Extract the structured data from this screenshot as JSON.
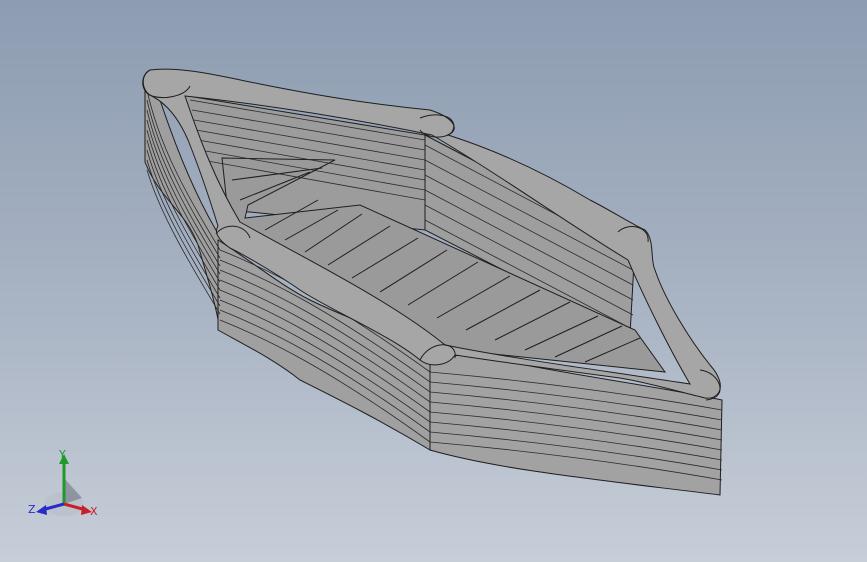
{
  "viewport": {
    "background_top": "#8d9cb1",
    "background_bottom": "#c7ced8"
  },
  "model": {
    "fill_color": "#a3a3a3",
    "edge_color": "#1e1e1e",
    "floor_color": "#9a9a9a"
  },
  "triad": {
    "icon": "coordinate-triad-icon",
    "x_label": "X",
    "y_label": "Y",
    "z_label": "Z",
    "x_color": "#c8202a",
    "y_color": "#1f9a2a",
    "z_color": "#2a2ac8"
  }
}
